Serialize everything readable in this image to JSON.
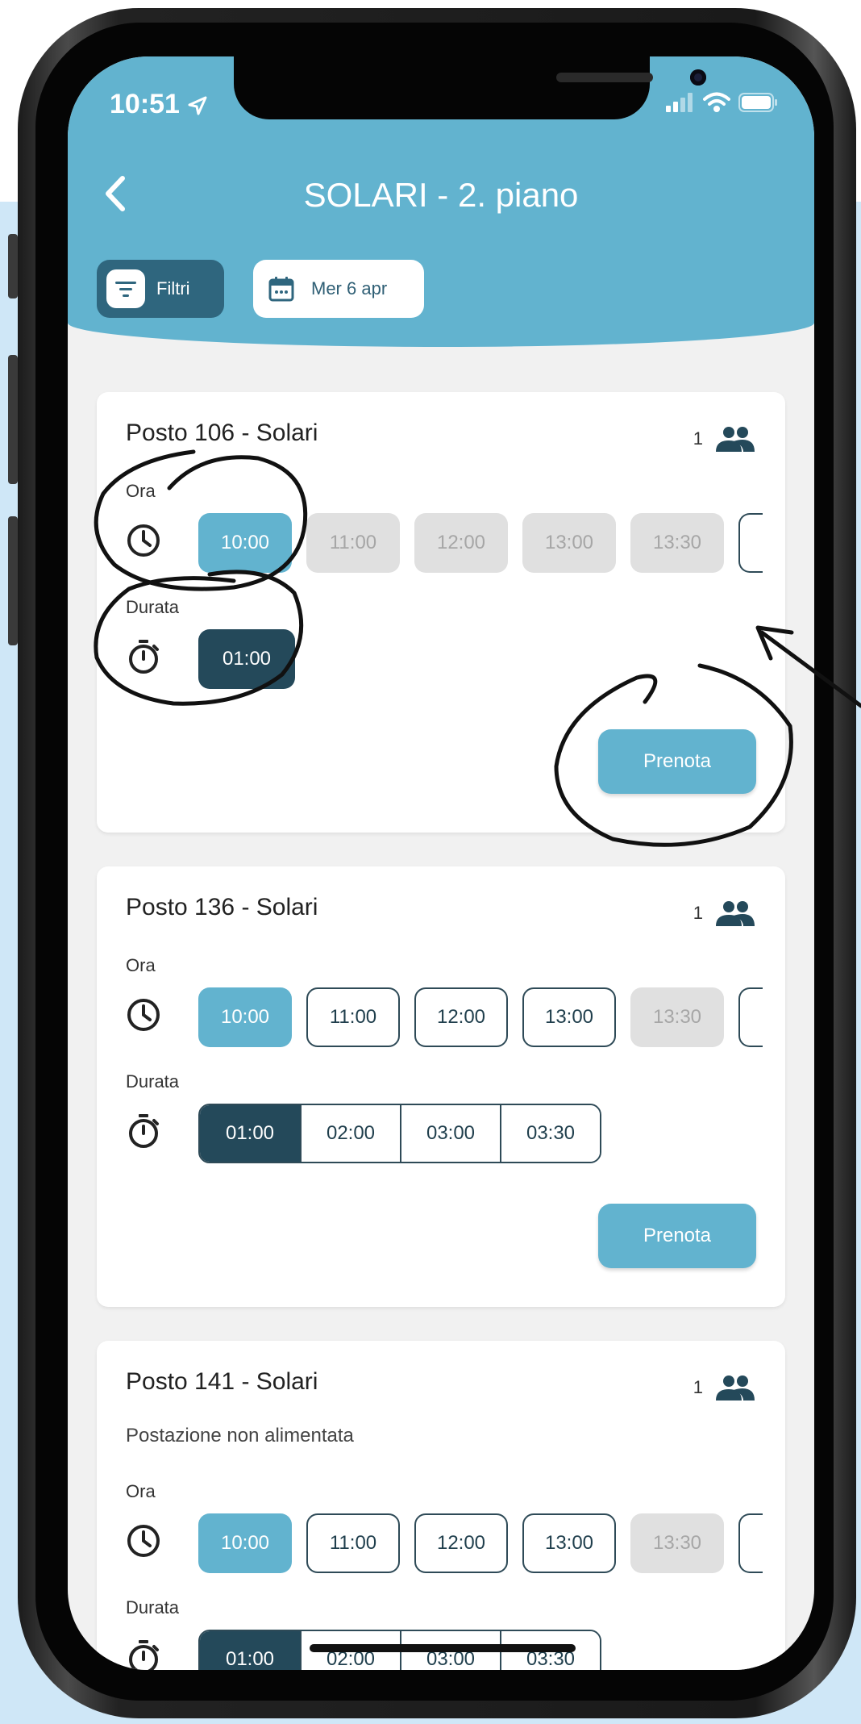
{
  "status": {
    "time": "10:51",
    "icons": [
      "location-arrow-icon",
      "signal-icon",
      "wifi-icon",
      "battery-icon"
    ]
  },
  "header": {
    "title": "SOLARI - 2. piano",
    "back_icon": "chevron-left-icon",
    "filter_label": "Filtri",
    "date_label": "Mer 6 apr"
  },
  "labels": {
    "ora": "Ora",
    "durata": "Durata",
    "prenota": "Prenota"
  },
  "cards": [
    {
      "title": "Posto 106 - Solari",
      "capacity": "1",
      "times": [
        {
          "label": "10:00",
          "state": "selected"
        },
        {
          "label": "11:00",
          "state": "disabled"
        },
        {
          "label": "12:00",
          "state": "disabled"
        },
        {
          "label": "13:00",
          "state": "disabled"
        },
        {
          "label": "13:30",
          "state": "disabled"
        }
      ],
      "durations": [
        {
          "label": "01:00",
          "state": "selected"
        }
      ]
    },
    {
      "title": "Posto 136 - Solari",
      "capacity": "1",
      "times": [
        {
          "label": "10:00",
          "state": "selected"
        },
        {
          "label": "11:00",
          "state": "available"
        },
        {
          "label": "12:00",
          "state": "available"
        },
        {
          "label": "13:00",
          "state": "available"
        },
        {
          "label": "13:30",
          "state": "disabled"
        }
      ],
      "durations": [
        {
          "label": "01:00",
          "state": "selected"
        },
        {
          "label": "02:00",
          "state": "available"
        },
        {
          "label": "03:00",
          "state": "available"
        },
        {
          "label": "03:30",
          "state": "available"
        }
      ]
    },
    {
      "title": "Posto 141 - Solari",
      "capacity": "1",
      "note": "Postazione non alimentata",
      "times": [
        {
          "label": "10:00",
          "state": "selected"
        },
        {
          "label": "11:00",
          "state": "available"
        },
        {
          "label": "12:00",
          "state": "available"
        },
        {
          "label": "13:00",
          "state": "available"
        },
        {
          "label": "13:30",
          "state": "disabled"
        }
      ],
      "durations": [
        {
          "label": "01:00",
          "state": "selected"
        },
        {
          "label": "02:00",
          "state": "available"
        },
        {
          "label": "03:00",
          "state": "available"
        },
        {
          "label": "03:30",
          "state": "available"
        }
      ]
    }
  ],
  "colors": {
    "header": "#62b3cf",
    "accent": "#62b3cf",
    "dark": "#24495a",
    "disabled": "#e0e0e0"
  }
}
